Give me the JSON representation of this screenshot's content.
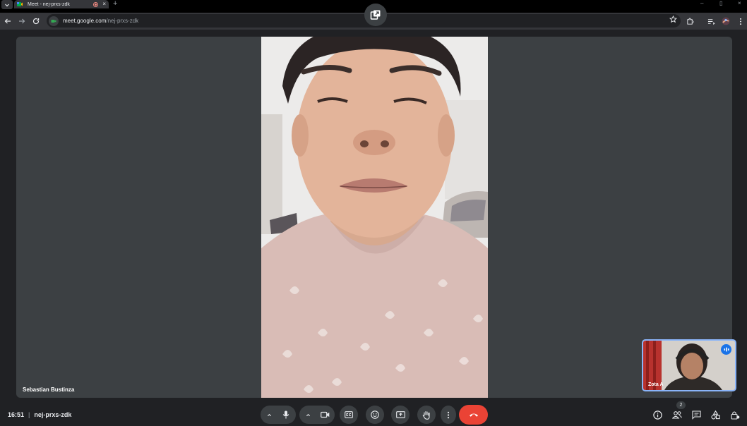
{
  "browser": {
    "tab_title": "Meet - nej-prxs-zdk",
    "tab_close": "×",
    "new_tab": "+",
    "url_host": "meet.google.com",
    "url_path": "/nej-prxs-zdk",
    "minimize": "–",
    "restore": "▯",
    "close": "×"
  },
  "meeting": {
    "main_speaker_name": "Sebastian Bustinza",
    "self_name": "Zota A",
    "time": "16:51",
    "separator": "|",
    "code": "nej-prxs-zdk",
    "participant_count": "2"
  },
  "colors": {
    "accent": "#8ab4f8",
    "hangup": "#ea4335",
    "stage": "#3c4043",
    "background": "#202124"
  }
}
